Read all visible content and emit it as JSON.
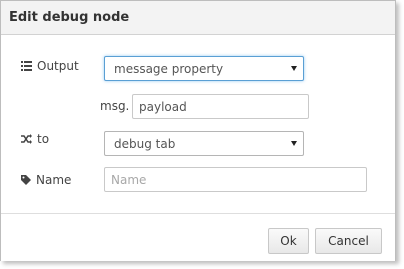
{
  "dialog": {
    "title": "Edit debug node"
  },
  "form": {
    "output": {
      "icon": "list-icon",
      "label": "Output",
      "selected": "message property"
    },
    "property": {
      "prefix": "msg.",
      "value": "payload"
    },
    "to": {
      "icon": "shuffle-icon",
      "label": "to",
      "selected": "debug tab"
    },
    "name": {
      "icon": "tag-icon",
      "label": "Name",
      "value": "",
      "placeholder": "Name"
    }
  },
  "buttons": {
    "ok_label": "Ok",
    "cancel_label": "Cancel"
  },
  "colors": {
    "focus_border": "#5a9fd4",
    "titlebar_bg": "#f3f3f3"
  }
}
